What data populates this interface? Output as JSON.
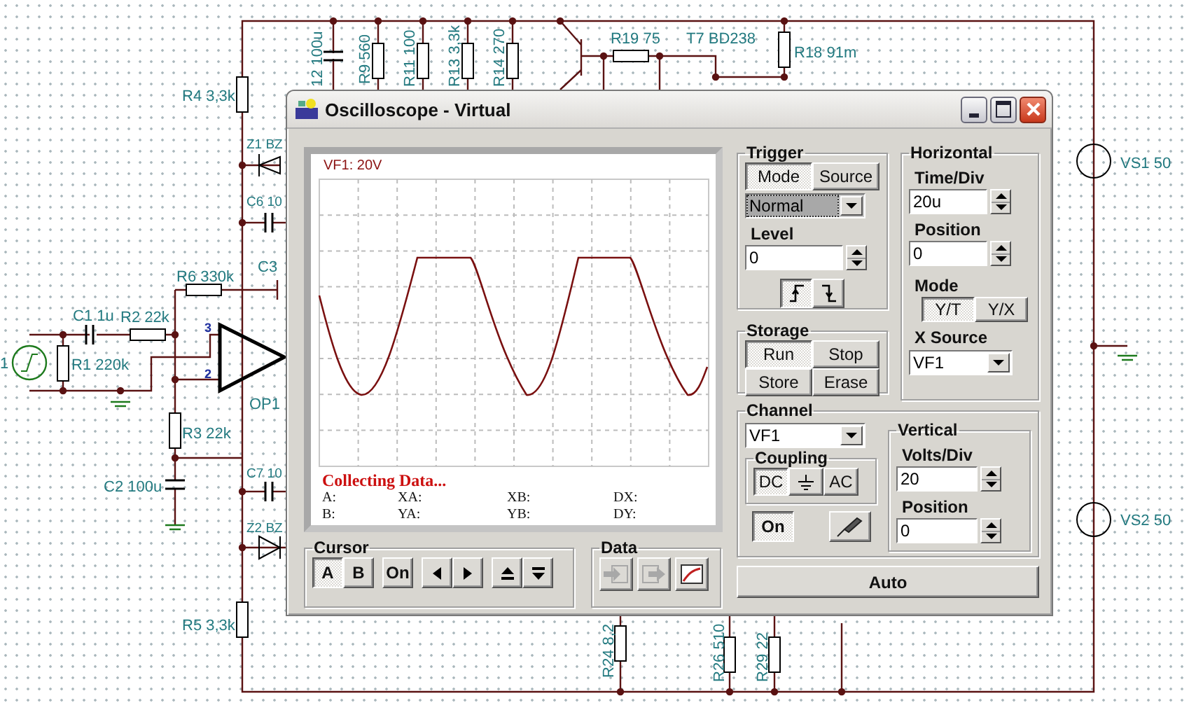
{
  "schematic": {
    "labels": [
      "1",
      "R4 3,3k",
      "Z1 BZ",
      "C6 10",
      "C3",
      "R6 330k",
      "C1 1u",
      "R2 22k",
      "R1 220k",
      "3",
      "2",
      "OP1",
      "R3 22k",
      "C2 100u",
      "C7 10",
      "Z2 BZ",
      "R5 3,3k",
      "12 100u",
      "R9 560",
      "R11 100",
      "R13 3,3k",
      "R14 270",
      "R19 75",
      "T7 BD238",
      "R18 91m",
      "R24 8,2",
      "R26 510",
      "R29 22",
      "VS1 50",
      "VS2 50"
    ]
  },
  "window": {
    "title": "Oscilloscope - Virtual"
  },
  "screen": {
    "channel_label": "VF1: 20V",
    "status": "Collecting Data...",
    "readouts": [
      "A:",
      "XA:",
      "XB:",
      "DX:",
      "B:",
      "YA:",
      "YB:",
      "DY:"
    ]
  },
  "cursor": {
    "title": "Cursor",
    "buttons": [
      {
        "label": "A",
        "selected": true
      },
      {
        "label": "B",
        "selected": false
      },
      {
        "label": "On",
        "selected": false
      }
    ]
  },
  "data": {
    "title": "Data",
    "buttons": [
      {
        "kind": "import",
        "disabled": true
      },
      {
        "kind": "export",
        "disabled": true
      },
      {
        "kind": "curve",
        "disabled": false
      }
    ]
  },
  "trigger": {
    "title": "Trigger",
    "tabs": [
      {
        "label": "Mode",
        "selected": true
      },
      {
        "label": "Source",
        "selected": false
      }
    ],
    "mode_value": "Normal",
    "level_label": "Level",
    "level_value": "0",
    "edges": [
      {
        "kind": "rising",
        "selected": true
      },
      {
        "kind": "falling",
        "selected": false
      }
    ]
  },
  "storage": {
    "title": "Storage",
    "buttons": [
      {
        "label": "Run",
        "selected": true
      },
      {
        "label": "Stop",
        "selected": false
      },
      {
        "label": "Store",
        "selected": false
      },
      {
        "label": "Erase",
        "selected": false
      }
    ]
  },
  "horizontal": {
    "title": "Horizontal",
    "time_div_label": "Time/Div",
    "time_div_value": "20u",
    "position_label": "Position",
    "position_value": "0",
    "mode_label": "Mode",
    "modes": [
      {
        "label": "Y/T",
        "selected": true
      },
      {
        "label": "Y/X",
        "selected": false
      }
    ],
    "x_source_label": "X Source",
    "x_source_value": "VF1"
  },
  "channel": {
    "title": "Channel",
    "value": "VF1",
    "coupling_title": "Coupling",
    "coupling": [
      {
        "kind": "text",
        "label": "DC",
        "selected": true
      },
      {
        "kind": "ground",
        "selected": false
      },
      {
        "kind": "text",
        "label": "AC",
        "selected": false
      }
    ],
    "on_button": {
      "label": "On",
      "selected": true
    }
  },
  "vertical": {
    "title": "Vertical",
    "volts_div_label": "Volts/Div",
    "volts_div_value": "20",
    "position_label": "Position",
    "position_value": "0"
  },
  "auto_button": "Auto"
}
